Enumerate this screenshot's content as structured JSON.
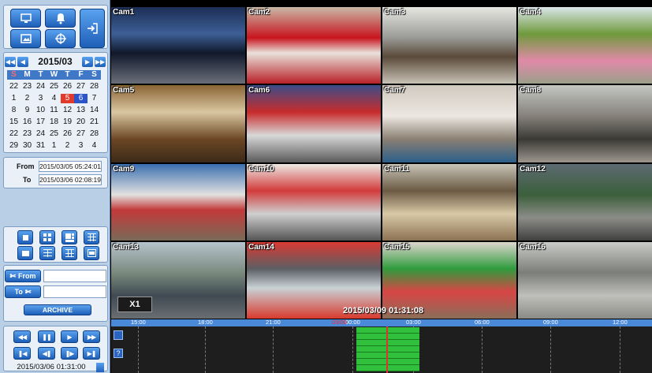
{
  "toolbar": {
    "buttons": [
      {
        "name": "monitor-layout-button",
        "icon": "monitor-icon"
      },
      {
        "name": "alarm-button",
        "icon": "bell-icon"
      },
      {
        "name": "logout-button",
        "icon": "exit-icon"
      },
      {
        "name": "snapshot-button",
        "icon": "camera-frame-icon"
      },
      {
        "name": "ptz-button",
        "icon": "crosshair-icon"
      }
    ]
  },
  "calendar": {
    "month": "2015/03",
    "weekdays": [
      "S",
      "M",
      "T",
      "W",
      "T",
      "F",
      "S"
    ],
    "weeks": [
      [
        "22",
        "23",
        "24",
        "25",
        "26",
        "27",
        "28"
      ],
      [
        "1",
        "2",
        "3",
        "4",
        "5",
        "6",
        "7"
      ],
      [
        "8",
        "9",
        "10",
        "11",
        "12",
        "13",
        "14"
      ],
      [
        "15",
        "16",
        "17",
        "18",
        "19",
        "20",
        "21"
      ],
      [
        "22",
        "23",
        "24",
        "25",
        "26",
        "27",
        "28"
      ],
      [
        "29",
        "30",
        "31",
        "1",
        "2",
        "3",
        "4"
      ]
    ],
    "highlight_red": "5",
    "highlight_blue": "6"
  },
  "search": {
    "from_label": "From",
    "from_value": "2015/03/05 05:24:01",
    "to_label": "To",
    "to_value": "2015/03/06 02:08:19"
  },
  "clip": {
    "from_label": "From",
    "to_label": "To",
    "archive_label": "ARCHIVE"
  },
  "playback": {
    "time": "2015/03/06 01:31:00"
  },
  "cameras": [
    "Cam1",
    "Cam2",
    "Cam3",
    "Cam4",
    "Cam5",
    "Cam6",
    "Cam7",
    "Cam8",
    "Cam9",
    "Cam10",
    "Cam11",
    "Cam12",
    "Cam13",
    "Cam14",
    "Cam15",
    "Cam16"
  ],
  "speed": "X1",
  "osd_timestamp": "2015/03/09 01:31:08",
  "timeline": {
    "ticks": [
      "15:00",
      "18:00",
      "21:00",
      "00:00",
      "03:00",
      "06:00",
      "09:00",
      "12:00"
    ],
    "date_marker": "03/06",
    "side_buttons": [
      "",
      "?"
    ]
  },
  "colors": {
    "accent": "#2a64c0",
    "recording": "#31c03c",
    "cursor": "#e03030"
  }
}
